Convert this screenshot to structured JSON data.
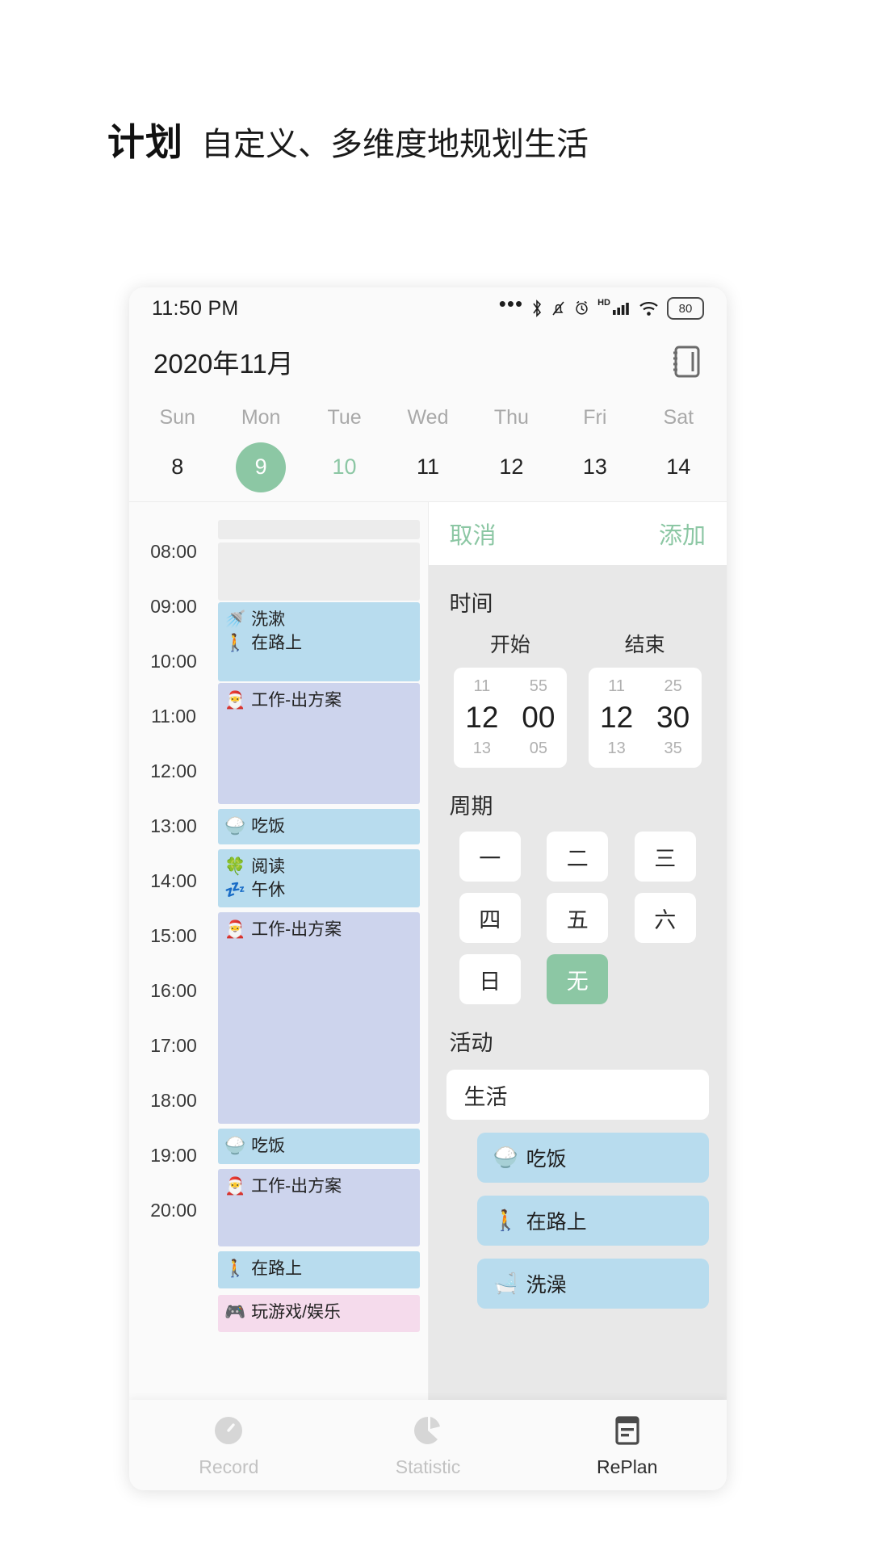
{
  "headline": {
    "title": "计划",
    "subtitle": "自定义、多维度地规划生活"
  },
  "statusbar": {
    "time": "11:50 PM",
    "battery": "80",
    "hd_label": "HD",
    "icons": [
      "more-dots-icon",
      "bluetooth-icon",
      "mute-bell-icon",
      "alarm-icon",
      "hd-icon",
      "signal-icon",
      "wifi-icon",
      "battery-icon"
    ]
  },
  "calendar": {
    "month_title": "2020年11月",
    "notebook_icon": "notebook-icon",
    "weekdays": [
      "Sun",
      "Mon",
      "Tue",
      "Wed",
      "Thu",
      "Fri",
      "Sat"
    ],
    "days": [
      {
        "num": "8",
        "state": "normal"
      },
      {
        "num": "9",
        "state": "selected"
      },
      {
        "num": "10",
        "state": "muted"
      },
      {
        "num": "11",
        "state": "normal"
      },
      {
        "num": "12",
        "state": "normal"
      },
      {
        "num": "13",
        "state": "normal"
      },
      {
        "num": "14",
        "state": "normal"
      }
    ],
    "selected_color": "#8cc7a4"
  },
  "timeline": {
    "hours": [
      "08:00",
      "09:00",
      "10:00",
      "11:00",
      "12:00",
      "13:00",
      "14:00",
      "15:00",
      "16:00",
      "17:00",
      "18:00",
      "19:00",
      "20:00"
    ],
    "events": [
      {
        "emoji": "",
        "label": "",
        "color": "blank"
      },
      {
        "emoji": "",
        "label": "",
        "color": "blank"
      },
      {
        "emoji": "🚿",
        "label": "洗漱",
        "emoji2": "🚶",
        "label2": "在路上",
        "color": "blue"
      },
      {
        "emoji": "🎅",
        "label": "工作-出方案",
        "color": "lav"
      },
      {
        "emoji": "🍚",
        "label": "吃饭",
        "color": "blue"
      },
      {
        "emoji": "🍀",
        "label": "阅读",
        "emoji2": "💤",
        "label2": "午休",
        "color": "blue"
      },
      {
        "emoji": "🎅",
        "label": "工作-出方案",
        "color": "lav"
      },
      {
        "emoji": "🍚",
        "label": "吃饭",
        "color": "blue"
      },
      {
        "emoji": "🎅",
        "label": "工作-出方案",
        "color": "lav"
      },
      {
        "emoji": "🚶",
        "label": "在路上",
        "color": "blue"
      },
      {
        "emoji": "🎮",
        "label": "玩游戏/娱乐",
        "color": "pink"
      }
    ]
  },
  "panel": {
    "cancel_label": "取消",
    "add_label": "添加",
    "time_section": "时间",
    "start_caption": "开始",
    "end_caption": "结束",
    "start_picker": {
      "prev_h": "11",
      "prev_m": "55",
      "h": "12",
      "m": "00",
      "next_h": "13",
      "next_m": "05"
    },
    "end_picker": {
      "prev_h": "11",
      "prev_m": "25",
      "h": "12",
      "m": "30",
      "next_h": "13",
      "next_m": "35"
    },
    "period_section": "周期",
    "weekdays": [
      {
        "label": "一",
        "selected": false
      },
      {
        "label": "二",
        "selected": false
      },
      {
        "label": "三",
        "selected": false
      },
      {
        "label": "四",
        "selected": false
      },
      {
        "label": "五",
        "selected": false
      },
      {
        "label": "六",
        "selected": false
      },
      {
        "label": "日",
        "selected": false
      },
      {
        "label": "无",
        "selected": true
      }
    ],
    "activity_section": "活动",
    "activity_value": "生活",
    "activity_items": [
      {
        "emoji": "🍚",
        "label": "吃饭"
      },
      {
        "emoji": "🚶",
        "label": "在路上"
      },
      {
        "emoji": "🛁",
        "label": "洗澡"
      }
    ]
  },
  "bottomnav": {
    "items": [
      {
        "label": "Record",
        "icon": "gauge-icon",
        "active": false
      },
      {
        "label": "Statistic",
        "icon": "pie-chart-icon",
        "active": false
      },
      {
        "label": "RePlan",
        "icon": "plan-document-icon",
        "active": true
      }
    ]
  }
}
